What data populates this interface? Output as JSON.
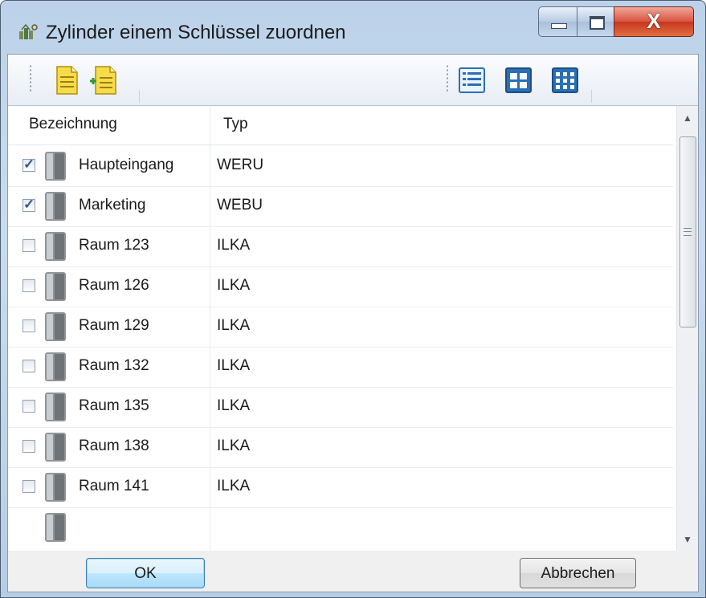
{
  "window": {
    "title": "Zylinder einem Schlüssel zuordnen",
    "close_glyph": "X"
  },
  "toolbar": {
    "left_buttons": [
      {
        "icon": "new-document-icon"
      },
      {
        "icon": "add-document-icon"
      }
    ],
    "right_buttons": [
      {
        "icon": "details-view-icon"
      },
      {
        "icon": "large-icons-view-icon"
      },
      {
        "icon": "small-icons-view-icon"
      }
    ]
  },
  "list": {
    "columns": [
      "Bezeichnung",
      "Typ"
    ],
    "rows": [
      {
        "checked": true,
        "name": "Haupteingang",
        "typ": "WERU"
      },
      {
        "checked": true,
        "name": "Marketing",
        "typ": "WEBU"
      },
      {
        "checked": false,
        "name": "Raum 123",
        "typ": "ILKA"
      },
      {
        "checked": false,
        "name": "Raum 126",
        "typ": "ILKA"
      },
      {
        "checked": false,
        "name": "Raum 129",
        "typ": "ILKA"
      },
      {
        "checked": false,
        "name": "Raum 132",
        "typ": "ILKA"
      },
      {
        "checked": false,
        "name": "Raum 135",
        "typ": "ILKA"
      },
      {
        "checked": false,
        "name": "Raum 138",
        "typ": "ILKA"
      },
      {
        "checked": false,
        "name": "Raum 141",
        "typ": "ILKA"
      }
    ],
    "row_icon": "cylinder-icon",
    "check_glyph": "✓",
    "scroll_up_glyph": "▲",
    "scroll_down_glyph": "▼"
  },
  "buttons": {
    "ok": "OK",
    "cancel": "Abbrechen"
  },
  "colors": {
    "titlebar": "#bcd2ea",
    "close_button": "#c63620",
    "ok_button": "#bee6fd",
    "document_icon": "#f5d43c"
  }
}
